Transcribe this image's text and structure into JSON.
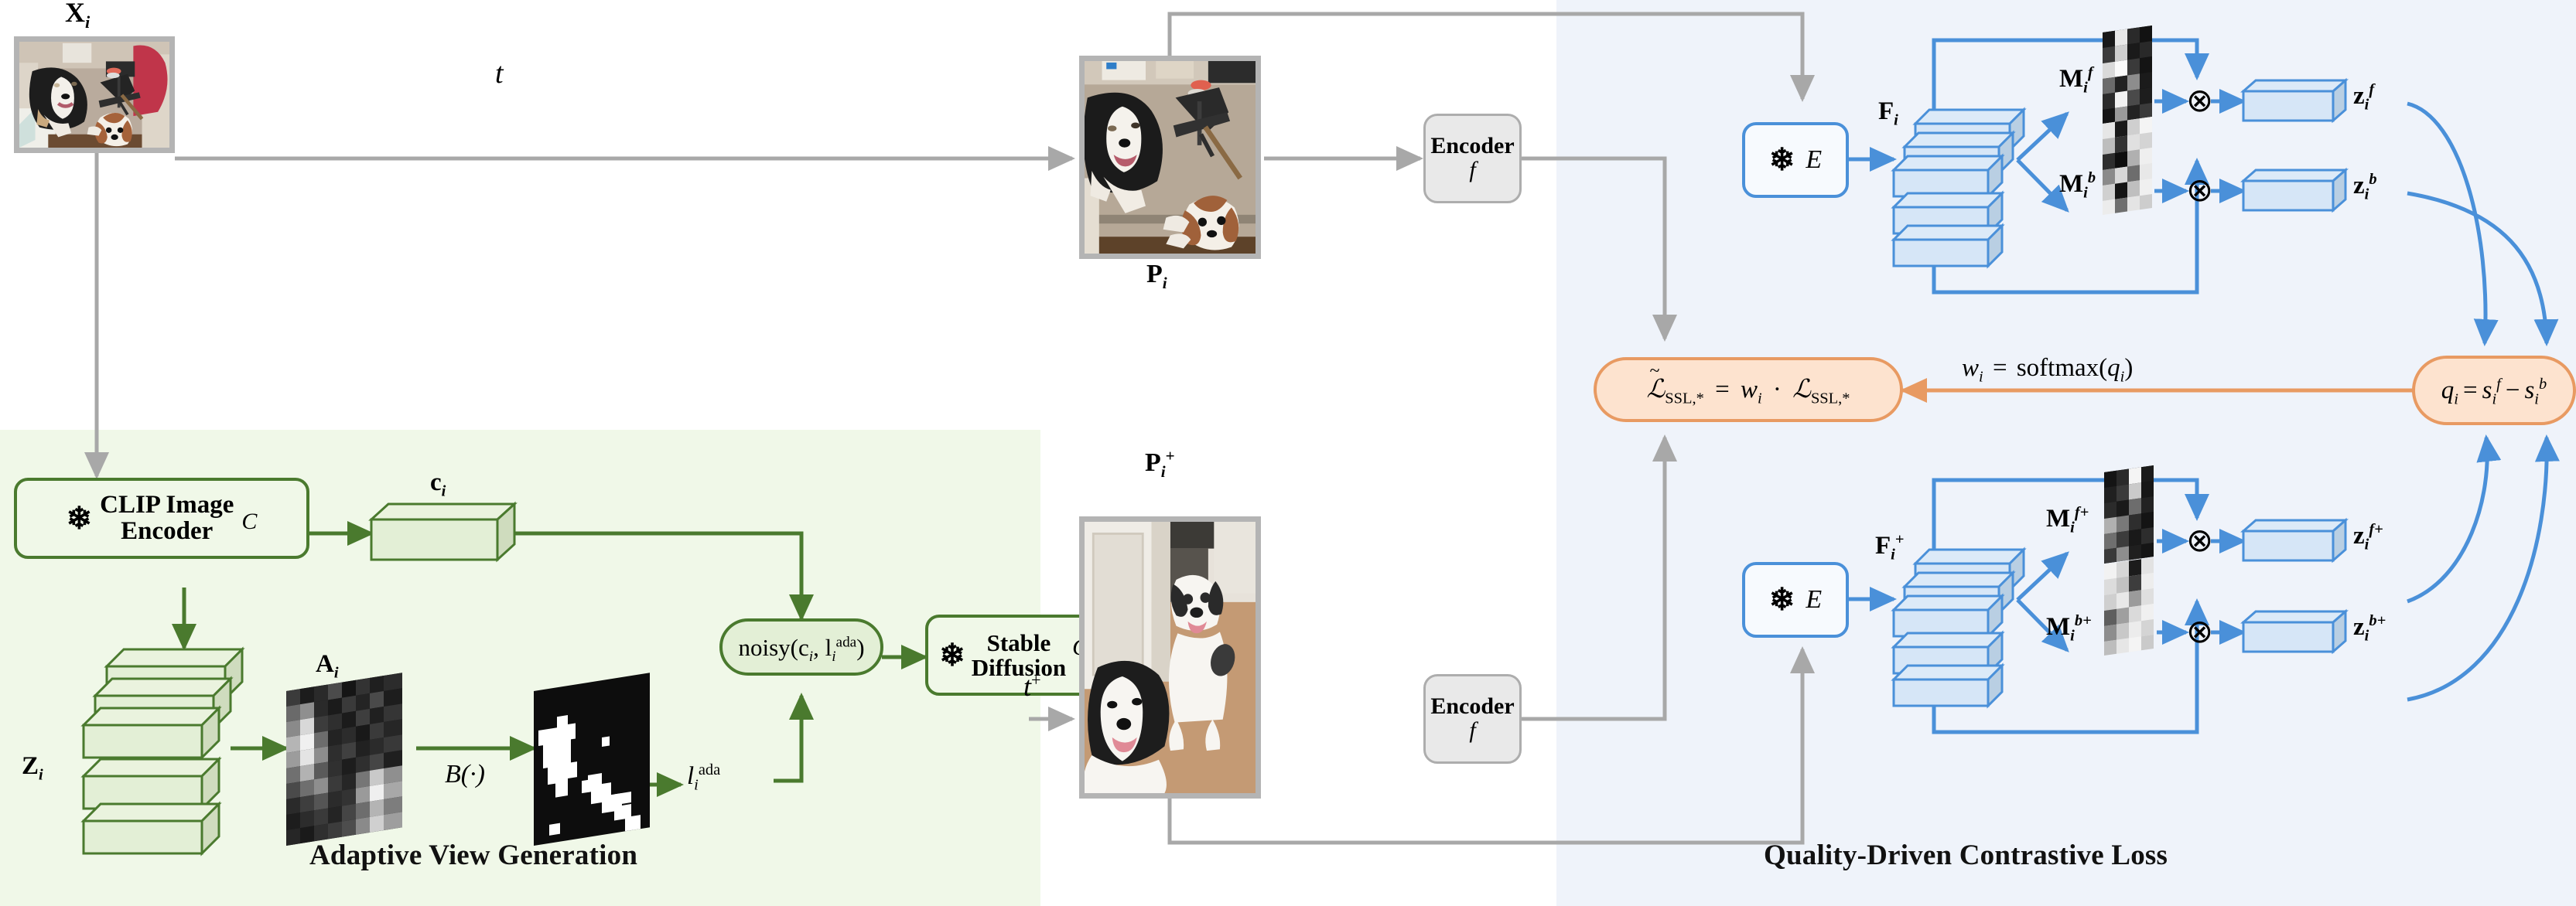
{
  "figure": {
    "title_left": "Adaptive View Generation",
    "title_right": "Quality-Driven Contrastive Loss"
  },
  "colors": {
    "green_panel": "#f0f8e8",
    "blue_panel": "#eff3fa",
    "green_stroke": "#4a7a2e",
    "blue_stroke": "#4a90d9",
    "orange_stroke": "#e89a62",
    "orange_fill": "#fde3cf",
    "gray_stroke": "#adadad",
    "gray_fill": "#e9e9e9"
  },
  "top_row": {
    "input_label": "X",
    "input_sub": "i",
    "transform_label": "t",
    "view_label": "P",
    "view_sub": "i",
    "encoder_label": "Encoder",
    "encoder_fn": "f"
  },
  "bottom_row": {
    "transform_label": "t",
    "transform_sup": "+",
    "view_label": "P",
    "view_sub": "i",
    "view_sup": "+",
    "encoder_label": "Encoder",
    "encoder_fn": "f"
  },
  "avg": {
    "clip_line1": "CLIP Image",
    "clip_line2": "Encoder",
    "clip_symbol": "C",
    "snowflake": "❄",
    "cond_label": "c",
    "cond_sub": "i",
    "latents_label": "Z",
    "latents_sub": "i",
    "attn_label": "A",
    "attn_sub": "i",
    "binarize_label": "B(·)",
    "level_label": "l",
    "level_sub": "i",
    "level_sup": "ada",
    "noisy_label": "noisy(c",
    "noisy_sub": "i",
    "noisy_mid": ", l",
    "noisy_sub2": "i",
    "noisy_sup2": "ada",
    "noisy_close": ")",
    "sd_line1": "Stable",
    "sd_line2": "Diffusion",
    "sd_symbol": "G"
  },
  "qdcl": {
    "frozen_encoder_symbol": "E",
    "snowflake": "❄",
    "top": {
      "features_label": "F",
      "features_sub": "i",
      "mask_fg_label": "M",
      "mask_fg_sub": "i",
      "mask_fg_sup": "f",
      "mask_bg_label": "M",
      "mask_bg_sub": "i",
      "mask_bg_sup": "b",
      "mul_symbol": "⊗",
      "z_fg_label": "z",
      "z_fg_sub": "i",
      "z_fg_sup": "f",
      "z_bg_label": "z",
      "z_bg_sub": "i",
      "z_bg_sup": "b"
    },
    "bottom": {
      "features_label": "F",
      "features_sub": "i",
      "features_sup": "+",
      "mask_fg_label": "M",
      "mask_fg_sub": "i",
      "mask_fg_sup": "f+",
      "mask_bg_label": "M",
      "mask_bg_sub": "i",
      "mask_bg_sup": "b+",
      "mul_symbol": "⊗",
      "z_fg_label": "z",
      "z_fg_sub": "i",
      "z_fg_sup": "f+",
      "z_bg_label": "z",
      "z_bg_sub": "i",
      "z_bg_sup": "b+"
    },
    "loss_formula": "ℒ̃_SSL,* = w_i · ℒ_SSL,*",
    "weight_formula": "w_i = softmax(q_i)",
    "quality_formula": "q_i = s_i^f − s_i^b"
  }
}
